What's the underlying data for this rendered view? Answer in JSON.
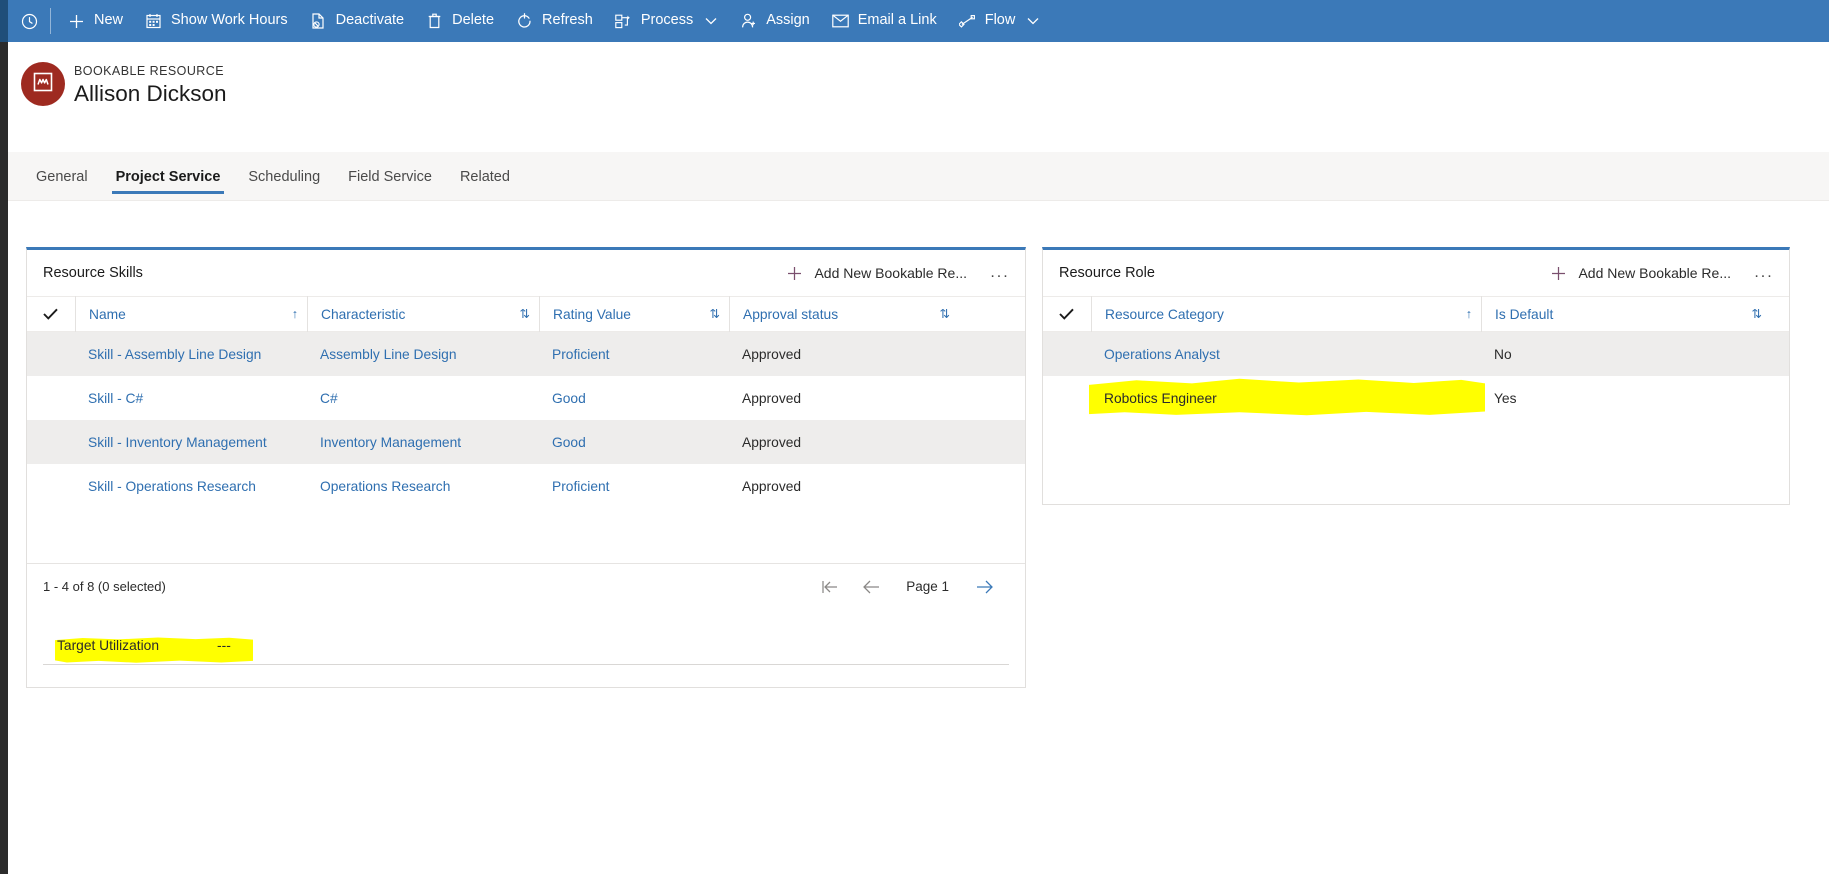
{
  "command_bar": {
    "expand_icon": "clock-icon",
    "buttons": [
      {
        "label": "New",
        "icon": "plus-icon",
        "has_chevron": false
      },
      {
        "label": "Show Work Hours",
        "icon": "calendar-icon",
        "has_chevron": false
      },
      {
        "label": "Deactivate",
        "icon": "file-block-icon",
        "has_chevron": false
      },
      {
        "label": "Delete",
        "icon": "trash-icon",
        "has_chevron": false
      },
      {
        "label": "Refresh",
        "icon": "refresh-icon",
        "has_chevron": false
      },
      {
        "label": "Process",
        "icon": "process-icon",
        "has_chevron": true
      },
      {
        "label": "Assign",
        "icon": "person-add-icon",
        "has_chevron": false
      },
      {
        "label": "Email a Link",
        "icon": "email-link-icon",
        "has_chevron": false
      },
      {
        "label": "Flow",
        "icon": "flow-icon",
        "has_chevron": true
      }
    ]
  },
  "record_header": {
    "entity_label": "BOOKABLE RESOURCE",
    "record_name": "Allison Dickson",
    "avatar_icon": "bookable-resource-icon",
    "avatar_color": "#9e2a20"
  },
  "tabs": [
    {
      "label": "General",
      "active": false
    },
    {
      "label": "Project Service",
      "active": true
    },
    {
      "label": "Scheduling",
      "active": false
    },
    {
      "label": "Field Service",
      "active": false
    },
    {
      "label": "Related",
      "active": false
    }
  ],
  "theme": {
    "command_bar_bg": "#3b79b8",
    "panel_accent": "#3b79b8",
    "link_color": "#2f6fb0",
    "highlight_color": "#ffff00"
  },
  "skills_panel": {
    "title": "Resource Skills",
    "add_button": "Add New Bookable Re...",
    "more_button": "...",
    "columns": [
      {
        "label": "Name",
        "sort": "asc"
      },
      {
        "label": "Characteristic",
        "sort": "both"
      },
      {
        "label": "Rating Value",
        "sort": "both"
      },
      {
        "label": "Approval status",
        "sort": "both"
      }
    ],
    "rows": [
      {
        "name": "Skill - Assembly Line Design",
        "characteristic": "Assembly Line Design",
        "rating": "Proficient",
        "approval": "Approved"
      },
      {
        "name": "Skill - C#",
        "characteristic": "C#",
        "rating": "Good",
        "approval": "Approved"
      },
      {
        "name": "Skill - Inventory Management",
        "characteristic": "Inventory Management",
        "rating": "Good",
        "approval": "Approved"
      },
      {
        "name": "Skill - Operations Research",
        "characteristic": "Operations Research",
        "rating": "Proficient",
        "approval": "Approved"
      }
    ],
    "footer": {
      "count_text": "1 - 4 of 8 (0 selected)",
      "first_page_icon": "first-page-arrow-icon",
      "prev_page_icon": "previous-page-arrow-icon",
      "page_label": "Page 1",
      "next_page_icon": "next-page-arrow-icon"
    },
    "target_utilization": {
      "label": "Target Utilization",
      "value": "---",
      "highlighted": true
    }
  },
  "role_panel": {
    "title": "Resource Role",
    "add_button": "Add New Bookable Re...",
    "more_button": "...",
    "columns": [
      {
        "label": "Resource Category",
        "sort": "asc"
      },
      {
        "label": "Is Default",
        "sort": "both"
      }
    ],
    "rows": [
      {
        "category": "Operations Analyst",
        "is_default": "No",
        "highlighted": false
      },
      {
        "category": "Robotics Engineer",
        "is_default": "Yes",
        "highlighted": true
      }
    ]
  }
}
